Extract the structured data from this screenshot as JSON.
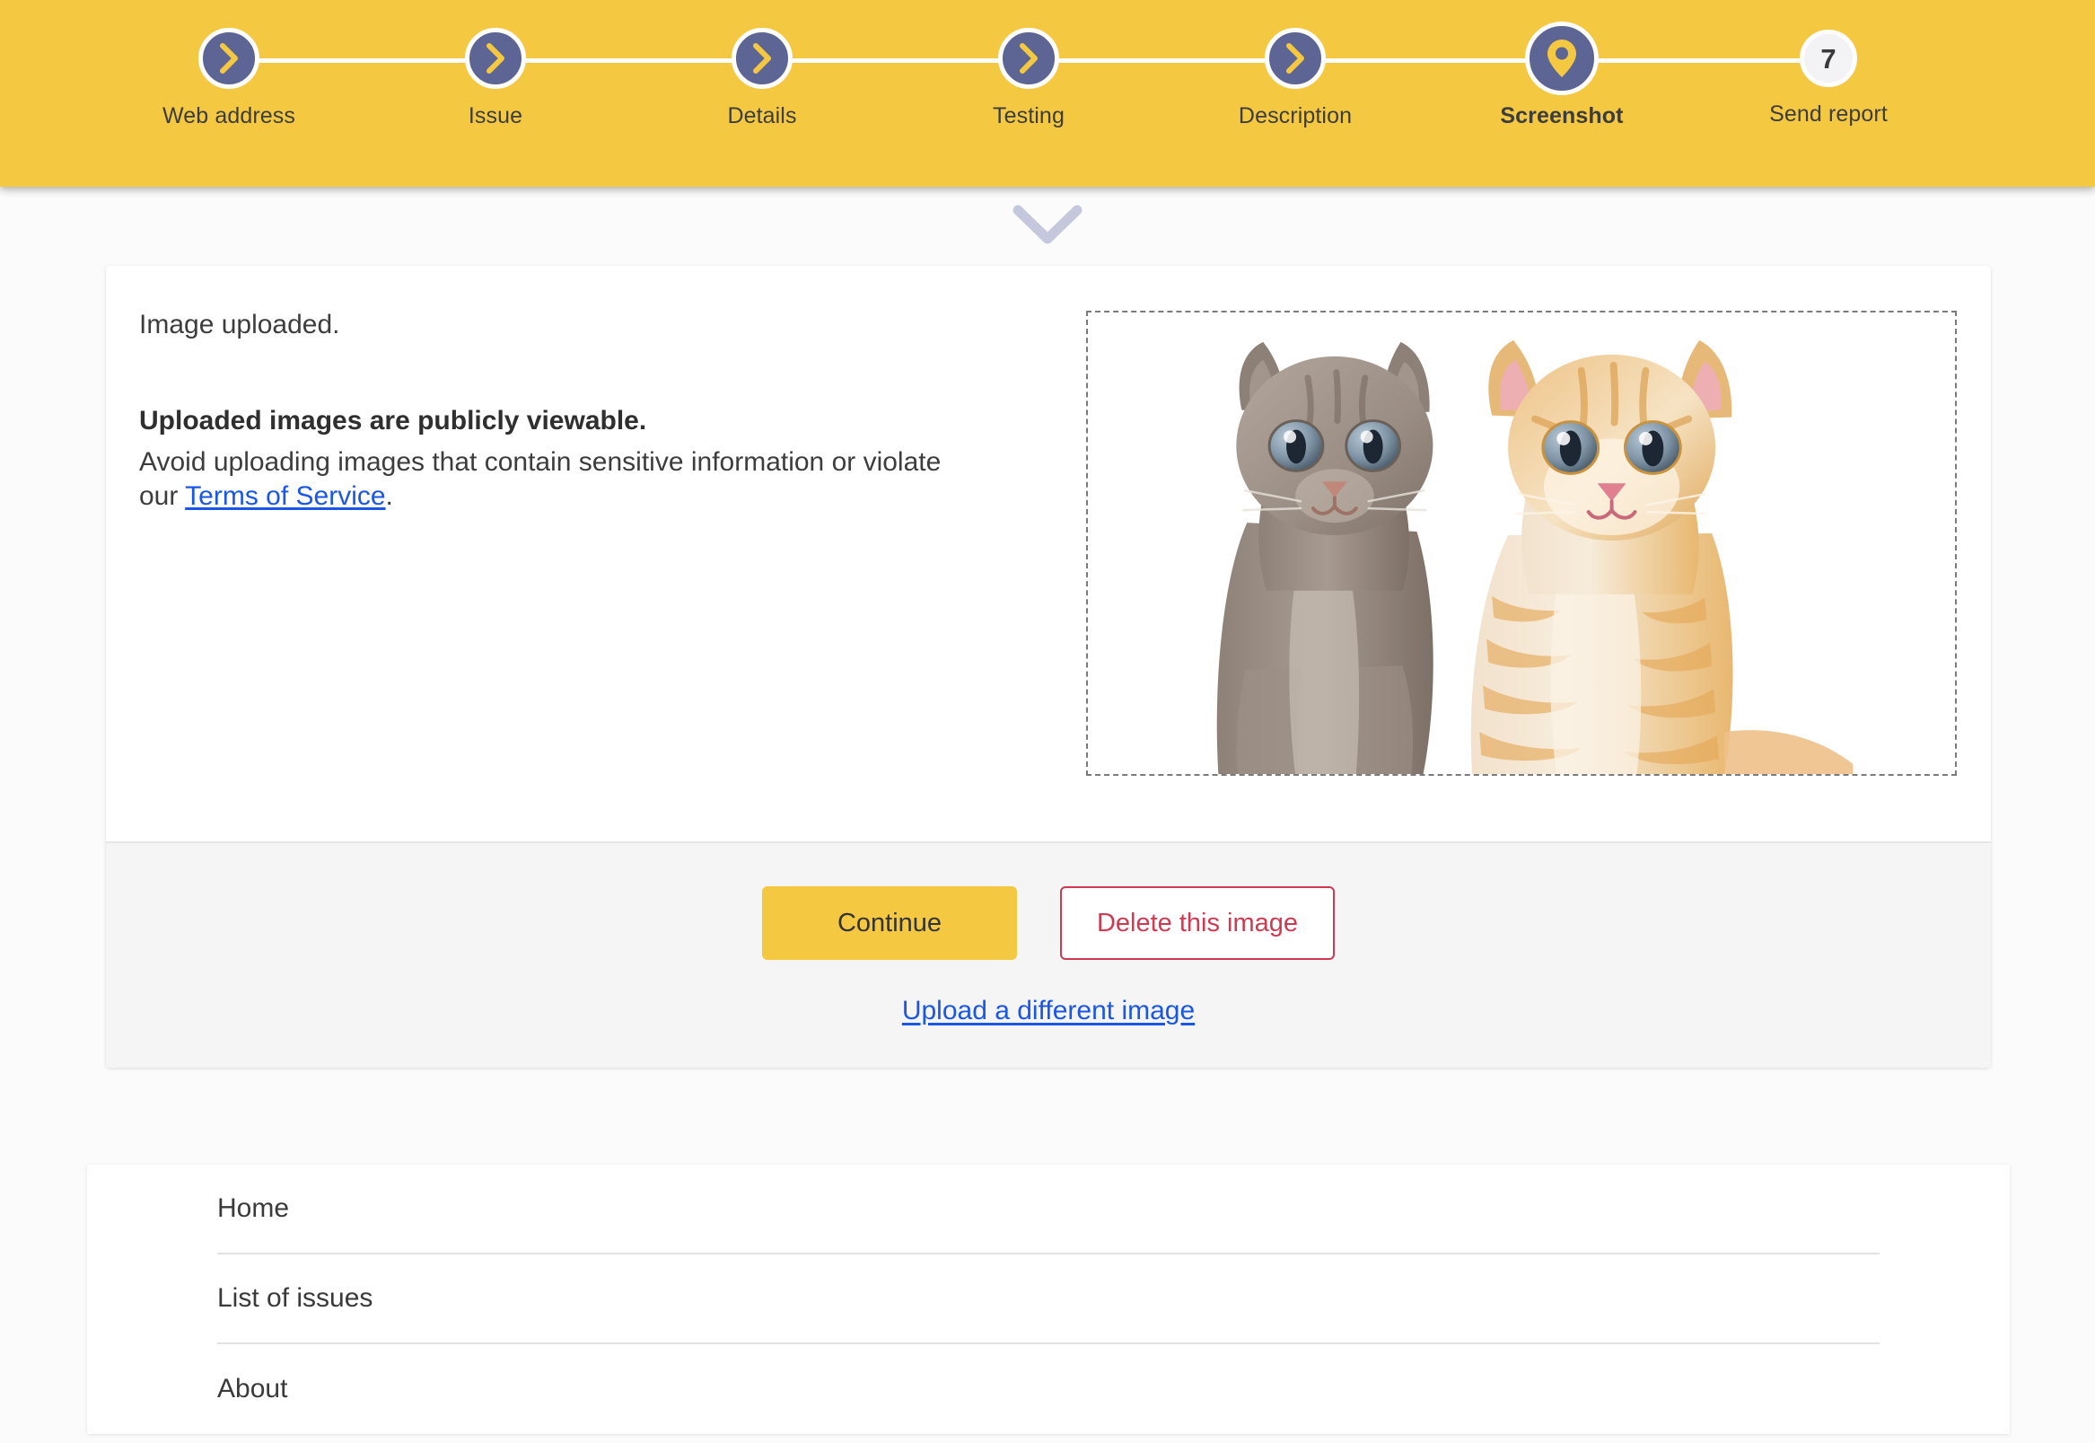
{
  "header": {
    "bg_color": "#f5c842",
    "circle_color": "#5c6593",
    "icon_color": "#f5c842",
    "steps": [
      {
        "label": "Web address",
        "icon": "chevron-right-icon",
        "state": "done",
        "number": "1"
      },
      {
        "label": "Issue",
        "icon": "chevron-right-icon",
        "state": "done",
        "number": "2"
      },
      {
        "label": "Details",
        "icon": "chevron-right-icon",
        "state": "done",
        "number": "3"
      },
      {
        "label": "Testing",
        "icon": "chevron-right-icon",
        "state": "done",
        "number": "4"
      },
      {
        "label": "Description",
        "icon": "chevron-right-icon",
        "state": "done",
        "number": "5"
      },
      {
        "label": "Screenshot",
        "icon": "map-pin-icon",
        "state": "current",
        "number": "6"
      },
      {
        "label": "Send report",
        "icon": "step-number",
        "state": "pending",
        "number": "7"
      }
    ]
  },
  "scroll_hint": {
    "icon": "chevron-down-icon",
    "color": "#c5c8dc"
  },
  "card": {
    "status_text": "Image uploaded.",
    "notice_heading": "Uploaded images are publicly viewable.",
    "notice_body_before": "Avoid uploading images that contain sensitive information or violate our ",
    "notice_link": "Terms of Service",
    "notice_body_after": ".",
    "preview": {
      "alt": "Uploaded screenshot preview: two kittens, one gray and one orange tabby, on a white background",
      "border_style": "dashed",
      "border_color": "#7b7b7b"
    },
    "actions": {
      "continue_label": "Continue",
      "delete_label": "Delete this image",
      "upload_different_label": "Upload a different image",
      "primary_color": "#f5c842",
      "danger_color": "#cf3a52",
      "link_color": "#1a56e8"
    }
  },
  "footer_nav": {
    "items": [
      {
        "label": "Home"
      },
      {
        "label": "List of issues"
      },
      {
        "label": "About"
      }
    ]
  }
}
